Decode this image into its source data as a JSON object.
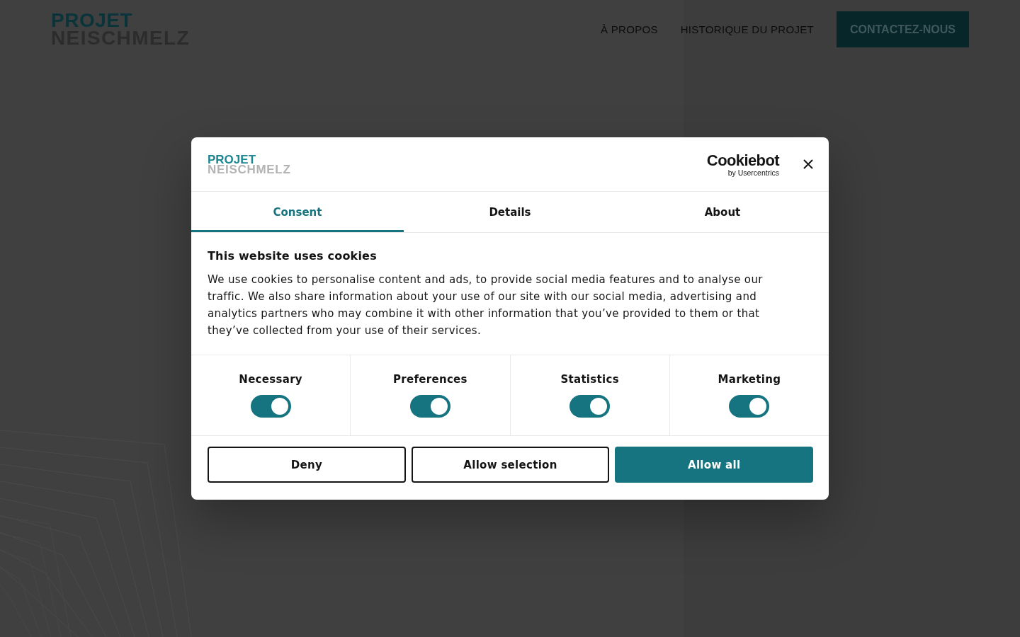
{
  "site_header": {
    "logo": {
      "title": "PROJET",
      "subtitle": "NEISCHMELZ"
    },
    "nav_links": [
      "À PROPOS",
      "HISTORIQUE DU PROJET"
    ],
    "cta_button": "CONTACTEZ-NOUS"
  },
  "cookie_dialog": {
    "logo": {
      "title": "PROJET",
      "subtitle": "NEISCHMELZ"
    },
    "provider_logo": {
      "name": "Cookiebot",
      "tagline": "by Usercentrics"
    },
    "tabs": [
      {
        "label": "Consent",
        "selected": true
      },
      {
        "label": "Details",
        "selected": false
      },
      {
        "label": "About",
        "selected": false
      }
    ],
    "heading": "This website uses cookies",
    "text": "We use cookies to personalise content and ads, to provide social media features and to analyse our traffic. We also share information about your use of our site with our social media, advertising and analytics partners who may combine it with other information that you’ve provided to them or that they’ve collected from your use of their services.",
    "categories": [
      {
        "label": "Necessary",
        "on": true
      },
      {
        "label": "Preferences",
        "on": true
      },
      {
        "label": "Statistics",
        "on": true
      },
      {
        "label": "Marketing",
        "on": true
      }
    ],
    "buttons": [
      {
        "label": "Deny",
        "kind": "outline"
      },
      {
        "label": "Allow selection",
        "kind": "outline"
      },
      {
        "label": "Allow all",
        "kind": "primary"
      }
    ]
  }
}
